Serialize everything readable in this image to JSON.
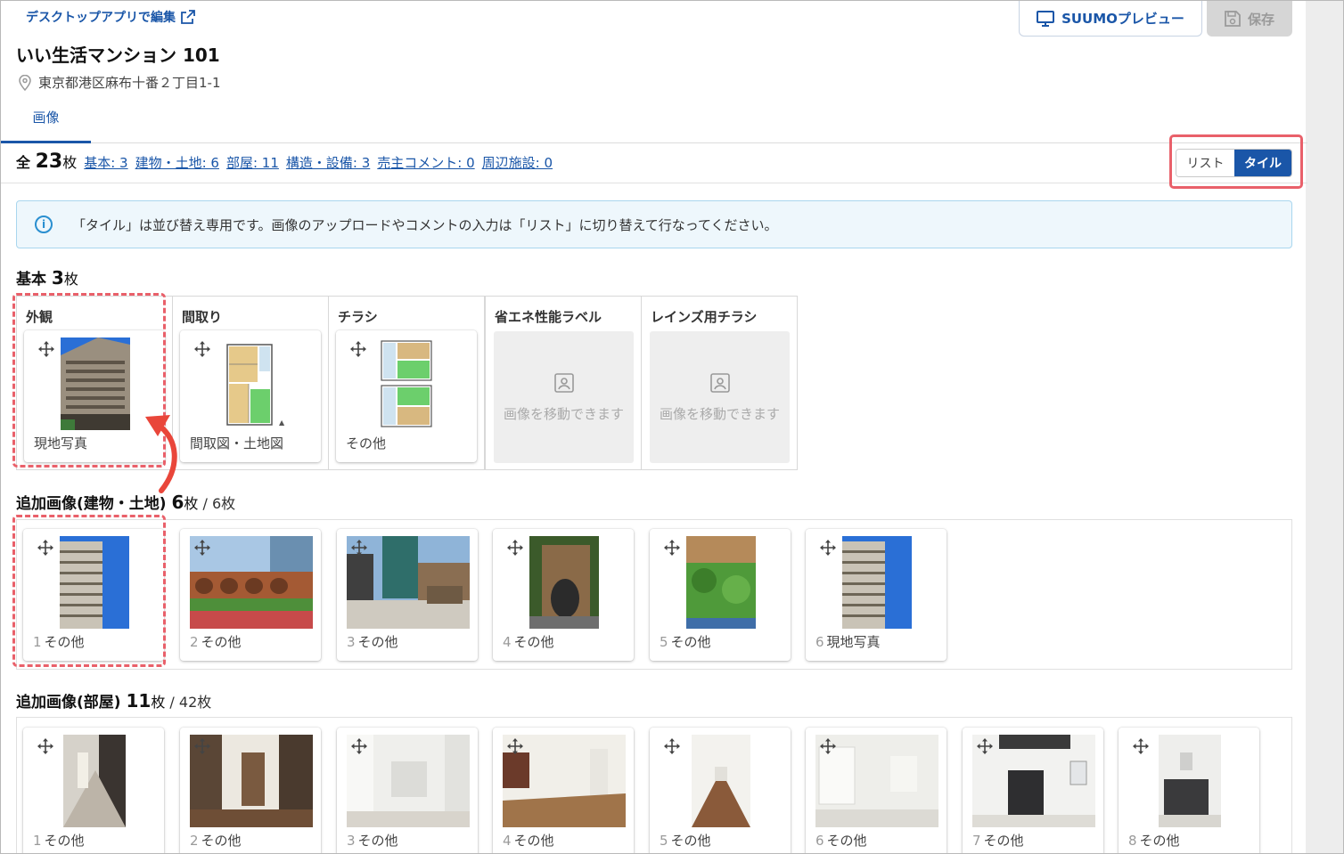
{
  "header": {
    "desktop_edit_link": "デスクトップアプリで編集",
    "preview_button": "SUUMOプレビュー",
    "save_button": "保存",
    "property_title": "いい生活マンション 101",
    "address": "東京都港区麻布十番２丁目1-1"
  },
  "tabs": [
    {
      "label": "画像"
    }
  ],
  "summary": {
    "total_prefix": "全",
    "total_count": "23",
    "total_unit": "枚",
    "categories": [
      {
        "label": "基本: 3"
      },
      {
        "label": "建物・土地: 6"
      },
      {
        "label": "部屋: 11"
      },
      {
        "label": "構造・設備: 3"
      },
      {
        "label": "売主コメント: 0"
      },
      {
        "label": "周辺施設: 0"
      }
    ]
  },
  "view_toggle": {
    "list": "リスト",
    "tile": "タイル",
    "selected": "tile"
  },
  "info_message": "「タイル」は並び替え専用です。画像のアップロードやコメントの入力は「リスト」に切り替えて行なってください。",
  "sections": {
    "basic": {
      "title": "基本",
      "count": "3",
      "unit": "枚",
      "slots": [
        {
          "label": "外観",
          "caption": "現地写真",
          "image": "building-exterior"
        },
        {
          "label": "間取り",
          "caption": "間取図・土地図",
          "image": "floorplan"
        },
        {
          "label": "チラシ",
          "caption": "その他",
          "image": "flyer-floorplan"
        },
        {
          "label": "省エネ性能ラベル",
          "empty_text": "画像を移動できます"
        },
        {
          "label": "レインズ用チラシ",
          "empty_text": "画像を移動できます"
        }
      ]
    },
    "building": {
      "title": "追加画像(建物・土地)",
      "count": "6",
      "unit": "枚",
      "total": " / 6枚",
      "items": [
        {
          "num": "1",
          "caption": "その他",
          "image": "building-tower"
        },
        {
          "num": "2",
          "caption": "その他",
          "image": "garden-arches"
        },
        {
          "num": "3",
          "caption": "その他",
          "image": "entrance-stairs"
        },
        {
          "num": "4",
          "caption": "その他",
          "image": "stone-entrance"
        },
        {
          "num": "5",
          "caption": "その他",
          "image": "greenery"
        },
        {
          "num": "6",
          "caption": "現地写真",
          "image": "building-tower"
        }
      ]
    },
    "room": {
      "title": "追加画像(部屋)",
      "count": "11",
      "unit": "枚",
      "total": " / 42枚",
      "items": [
        {
          "num": "1",
          "caption": "その他",
          "image": "hallway"
        },
        {
          "num": "2",
          "caption": "その他",
          "image": "entry-door"
        },
        {
          "num": "3",
          "caption": "その他",
          "image": "white-room"
        },
        {
          "num": "4",
          "caption": "その他",
          "image": "living-room"
        },
        {
          "num": "5",
          "caption": "その他",
          "image": "corridor"
        },
        {
          "num": "6",
          "caption": "その他",
          "image": "bright-room"
        },
        {
          "num": "7",
          "caption": "その他",
          "image": "kitchen-island"
        },
        {
          "num": "8",
          "caption": "その他",
          "image": "kitchen"
        }
      ]
    }
  },
  "colors": {
    "primary": "#1a56a8",
    "highlight": "#e9606a",
    "info_bg": "#eef7fc"
  }
}
